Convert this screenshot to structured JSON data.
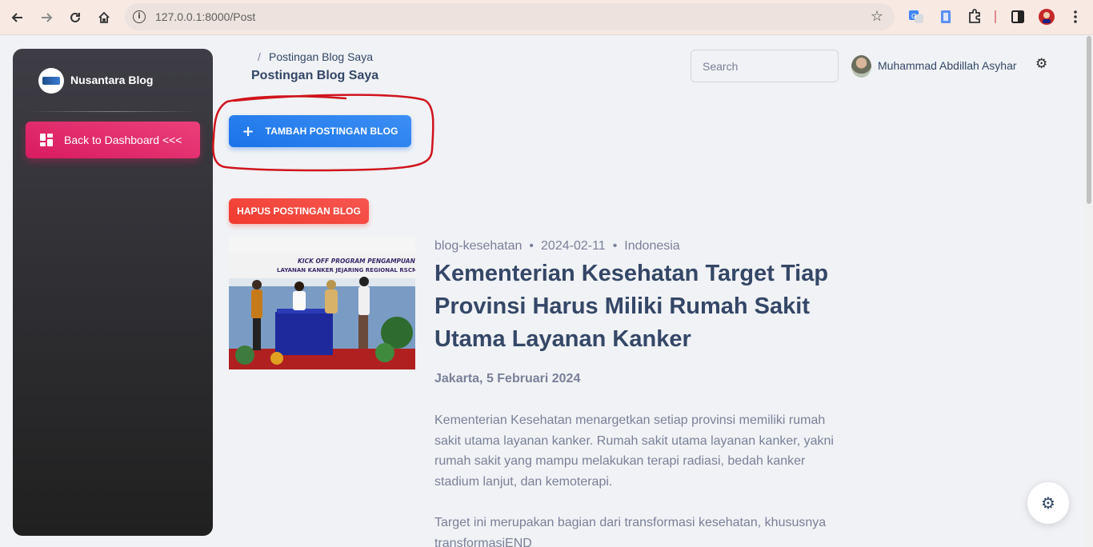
{
  "browser": {
    "url": "127.0.0.1:8000/Post"
  },
  "sidebar": {
    "brand": "Nusantara Blog",
    "back_button": "Back to Dashboard <<<"
  },
  "header": {
    "breadcrumb_separator": "/",
    "breadcrumb": "Postingan Blog Saya",
    "title": "Postingan Blog Saya",
    "search_placeholder": "Search",
    "user_name": "Muhammad Abdillah Asyhar"
  },
  "actions": {
    "add_label": "TAMBAH POSTINGAN BLOG",
    "delete_label": "HAPUS POSTINGAN BLOG"
  },
  "post": {
    "category": "blog-kesehatan",
    "date": "2024-02-11",
    "country": "Indonesia",
    "meta_separator": "•",
    "title": "Kementerian Kesehatan Target Tiap Provinsi Harus Miliki Rumah Sakit Utama Layanan Kanker",
    "dateline": "Jakarta, 5 Februari 2024",
    "paragraph1": "Kementerian Kesehatan menargetkan setiap provinsi memiliki rumah sakit utama layanan kanker. Rumah sakit utama layanan kanker, yakni rumah sakit yang mampu melakukan terapi radiasi, bedah kanker stadium lanjut, dan kemoterapi.",
    "paragraph2": "Target ini merupakan bagian dari transformasi kesehatan, khususnya transformasiEND",
    "image_banner_line1": "KICK OFF PROGRAM PENGAMPUAN",
    "image_banner_line2": "LAYANAN KANKER JEJARING REGIONAL RSCM"
  },
  "colors": {
    "primary": "#1a73e8",
    "pink": "#e91e63",
    "danger": "#f44335",
    "annotation": "#d0141c"
  }
}
